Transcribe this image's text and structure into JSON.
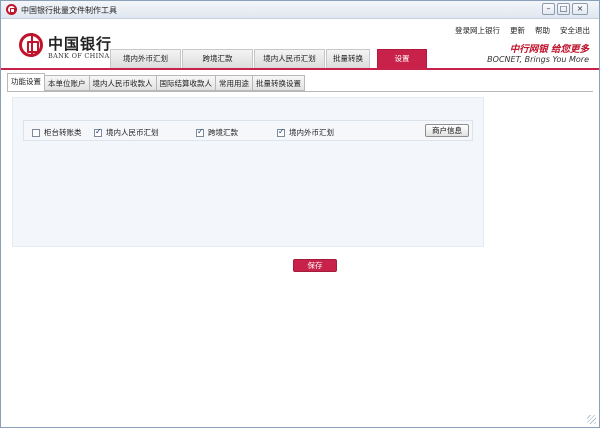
{
  "window": {
    "title": "中国银行批量文件制作工具",
    "controls": {
      "minimize": "–",
      "maximize": "□",
      "close": "×"
    }
  },
  "header": {
    "logo_cn": "中国银行",
    "logo_en": "BANK OF CHINA",
    "links": [
      "登录网上银行",
      "更新",
      "帮助",
      "安全退出"
    ],
    "slogan_primary": "中行网银 给您更多",
    "slogan_secondary": "BOCNET, Brings You More",
    "accent_color": "#c8224a"
  },
  "main_tabs": [
    {
      "label": "境内外币汇划",
      "active": false
    },
    {
      "label": "跨境汇款",
      "active": false
    },
    {
      "label": "境内人民币汇划",
      "active": false
    },
    {
      "label": "批量转换",
      "active": false
    },
    {
      "label": "设置",
      "active": true
    }
  ],
  "sub_tabs": [
    {
      "label": "功能设置",
      "active": true
    },
    {
      "label": "本单位账户",
      "active": false
    },
    {
      "label": "境内人民币收款人",
      "active": false
    },
    {
      "label": "国际结算收款人",
      "active": false
    },
    {
      "label": "常用用途",
      "active": false
    },
    {
      "label": "批量转换设置",
      "active": false
    }
  ],
  "options": [
    {
      "label": "柜台转账类",
      "checked": false
    },
    {
      "label": "境内人民币汇划",
      "checked": true
    },
    {
      "label": "跨境汇款",
      "checked": true
    },
    {
      "label": "境内外币汇划",
      "checked": true
    }
  ],
  "buttons": {
    "account_info": "商户信息",
    "save": "保存"
  }
}
